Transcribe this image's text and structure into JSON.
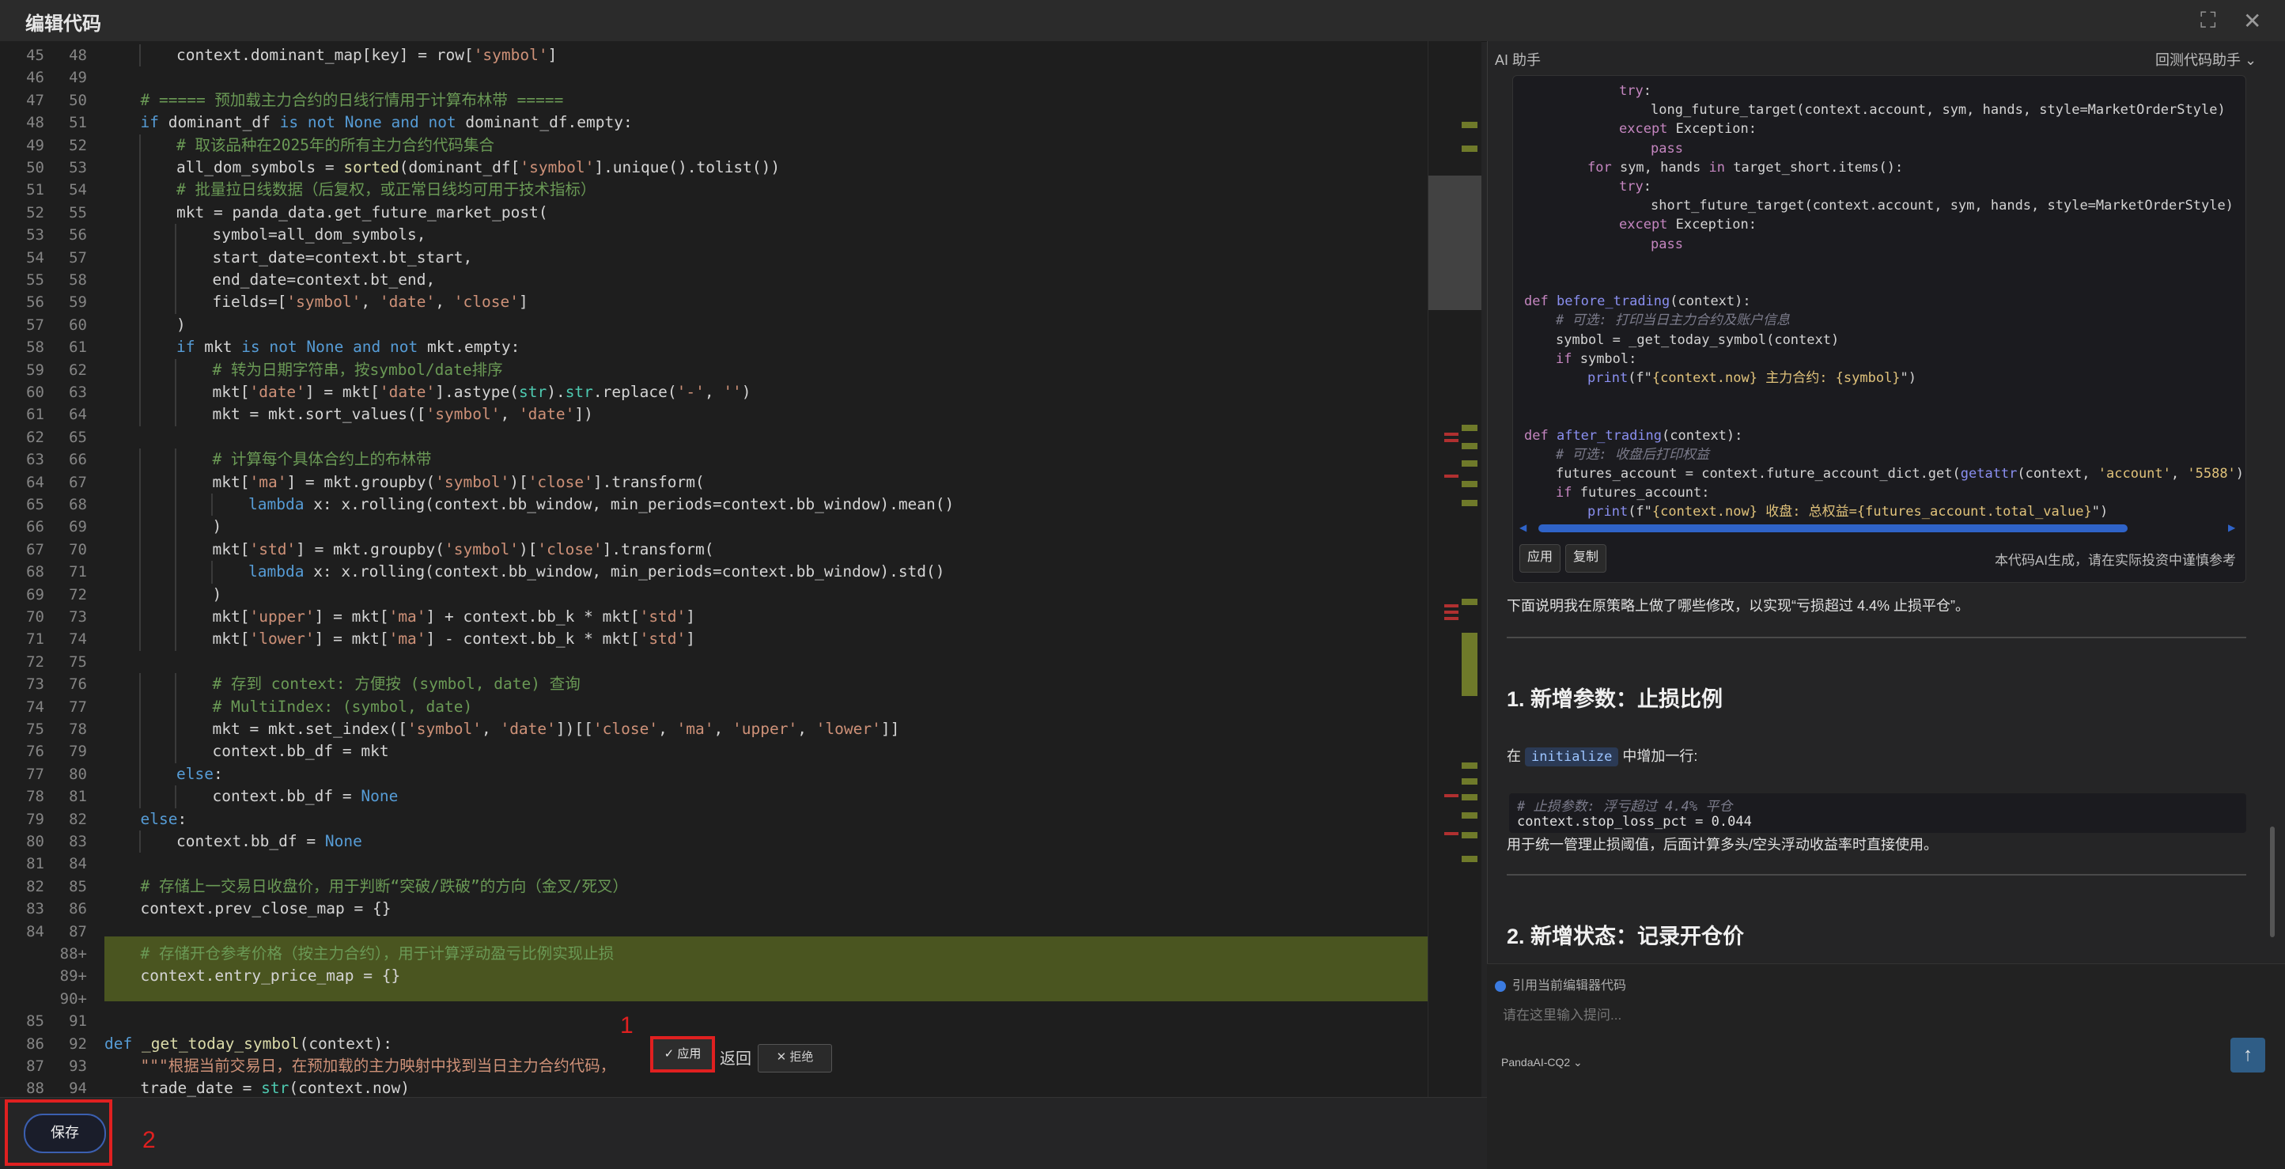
{
  "window": {
    "title": "编辑代码",
    "fullscreen_icon": "fullscreen-icon",
    "close_icon": "close-icon"
  },
  "editor": {
    "lines": [
      {
        "o": "45",
        "n": "48",
        "i": 2,
        "t": [
          [
            "",
            "context.dominant_map[key] = row["
          ],
          [
            "st",
            "'symbol'"
          ],
          [
            "",
            "]"
          ]
        ]
      },
      {
        "o": "46",
        "n": "49",
        "i": 0,
        "t": [
          [
            "",
            ""
          ]
        ]
      },
      {
        "o": "47",
        "n": "50",
        "i": 1,
        "t": [
          [
            "cm",
            "# ===== 预加载主力合约的日线行情用于计算布林带 ====="
          ]
        ]
      },
      {
        "o": "48",
        "n": "51",
        "i": 1,
        "t": [
          [
            "kw",
            "if"
          ],
          [
            "",
            " dominant_df "
          ],
          [
            "kw",
            "is not None and not"
          ],
          [
            "",
            " dominant_df.empty:"
          ]
        ]
      },
      {
        "o": "49",
        "n": "52",
        "i": 2,
        "t": [
          [
            "cm",
            "# 取该品种在2025年的所有主力合约代码集合"
          ]
        ]
      },
      {
        "o": "50",
        "n": "53",
        "i": 2,
        "t": [
          [
            "",
            "all_dom_symbols = "
          ],
          [
            "fn",
            "sorted"
          ],
          [
            "",
            "(dominant_df["
          ],
          [
            "st",
            "'symbol'"
          ],
          [
            "",
            "].unique().tolist())"
          ]
        ]
      },
      {
        "o": "51",
        "n": "54",
        "i": 2,
        "t": [
          [
            "cm",
            "# 批量拉日线数据（后复权，或正常日线均可用于技术指标）"
          ]
        ]
      },
      {
        "o": "52",
        "n": "55",
        "i": 2,
        "t": [
          [
            "",
            "mkt = panda_data.get_future_market_post("
          ]
        ]
      },
      {
        "o": "53",
        "n": "56",
        "i": 3,
        "t": [
          [
            "",
            "symbol=all_dom_symbols,"
          ]
        ]
      },
      {
        "o": "54",
        "n": "57",
        "i": 3,
        "t": [
          [
            "",
            "start_date=context.bt_start,"
          ]
        ]
      },
      {
        "o": "55",
        "n": "58",
        "i": 3,
        "t": [
          [
            "",
            "end_date=context.bt_end,"
          ]
        ]
      },
      {
        "o": "56",
        "n": "59",
        "i": 3,
        "t": [
          [
            "",
            "fields=["
          ],
          [
            "st",
            "'symbol'"
          ],
          [
            "",
            ", "
          ],
          [
            "st",
            "'date'"
          ],
          [
            "",
            ", "
          ],
          [
            "st",
            "'close'"
          ],
          [
            "",
            "]"
          ]
        ]
      },
      {
        "o": "57",
        "n": "60",
        "i": 2,
        "t": [
          [
            "",
            ")"
          ]
        ]
      },
      {
        "o": "58",
        "n": "61",
        "i": 2,
        "t": [
          [
            "kw",
            "if"
          ],
          [
            "",
            " mkt "
          ],
          [
            "kw",
            "is not None and not"
          ],
          [
            "",
            " mkt.empty:"
          ]
        ]
      },
      {
        "o": "59",
        "n": "62",
        "i": 3,
        "t": [
          [
            "cm",
            "# 转为日期字符串，按symbol/date排序"
          ]
        ]
      },
      {
        "o": "60",
        "n": "63",
        "i": 3,
        "t": [
          [
            "",
            "mkt["
          ],
          [
            "st",
            "'date'"
          ],
          [
            "",
            "] = mkt["
          ],
          [
            "st",
            "'date'"
          ],
          [
            "",
            "].astype("
          ],
          [
            "bt",
            "str"
          ],
          [
            "",
            ")."
          ],
          [
            "bt",
            "str"
          ],
          [
            "",
            ".replace("
          ],
          [
            "st",
            "'-'"
          ],
          [
            "",
            ", "
          ],
          [
            "st",
            "''"
          ],
          [
            "",
            ")"
          ]
        ]
      },
      {
        "o": "61",
        "n": "64",
        "i": 3,
        "t": [
          [
            "",
            "mkt = mkt.sort_values(["
          ],
          [
            "st",
            "'symbol'"
          ],
          [
            "",
            ", "
          ],
          [
            "st",
            "'date'"
          ],
          [
            "",
            "])"
          ]
        ]
      },
      {
        "o": "62",
        "n": "65",
        "i": 0,
        "t": [
          [
            "",
            ""
          ]
        ]
      },
      {
        "o": "63",
        "n": "66",
        "i": 3,
        "t": [
          [
            "cm",
            "# 计算每个具体合约上的布林带"
          ]
        ]
      },
      {
        "o": "64",
        "n": "67",
        "i": 3,
        "t": [
          [
            "",
            "mkt["
          ],
          [
            "st",
            "'ma'"
          ],
          [
            "",
            "] = mkt.groupby("
          ],
          [
            "st",
            "'symbol'"
          ],
          [
            "",
            ")["
          ],
          [
            "st",
            "'close'"
          ],
          [
            "",
            "].transform("
          ]
        ]
      },
      {
        "o": "65",
        "n": "68",
        "i": 4,
        "t": [
          [
            "kw",
            "lambda"
          ],
          [
            "",
            " x: x.rolling(context.bb_window, min_periods=context.bb_window).mean()"
          ]
        ]
      },
      {
        "o": "66",
        "n": "69",
        "i": 3,
        "t": [
          [
            "",
            ")"
          ]
        ]
      },
      {
        "o": "67",
        "n": "70",
        "i": 3,
        "t": [
          [
            "",
            "mkt["
          ],
          [
            "st",
            "'std'"
          ],
          [
            "",
            "] = mkt.groupby("
          ],
          [
            "st",
            "'symbol'"
          ],
          [
            "",
            ")["
          ],
          [
            "st",
            "'close'"
          ],
          [
            "",
            "].transform("
          ]
        ]
      },
      {
        "o": "68",
        "n": "71",
        "i": 4,
        "t": [
          [
            "kw",
            "lambda"
          ],
          [
            "",
            " x: x.rolling(context.bb_window, min_periods=context.bb_window).std()"
          ]
        ]
      },
      {
        "o": "69",
        "n": "72",
        "i": 3,
        "t": [
          [
            "",
            ")"
          ]
        ]
      },
      {
        "o": "70",
        "n": "73",
        "i": 3,
        "t": [
          [
            "",
            "mkt["
          ],
          [
            "st",
            "'upper'"
          ],
          [
            "",
            "] = mkt["
          ],
          [
            "st",
            "'ma'"
          ],
          [
            "",
            "] + context.bb_k * mkt["
          ],
          [
            "st",
            "'std'"
          ],
          [
            "",
            "]"
          ]
        ]
      },
      {
        "o": "71",
        "n": "74",
        "i": 3,
        "t": [
          [
            "",
            "mkt["
          ],
          [
            "st",
            "'lower'"
          ],
          [
            "",
            "] = mkt["
          ],
          [
            "st",
            "'ma'"
          ],
          [
            "",
            "] - context.bb_k * mkt["
          ],
          [
            "st",
            "'std'"
          ],
          [
            "",
            "]"
          ]
        ]
      },
      {
        "o": "72",
        "n": "75",
        "i": 0,
        "t": [
          [
            "",
            ""
          ]
        ]
      },
      {
        "o": "73",
        "n": "76",
        "i": 3,
        "t": [
          [
            "cm",
            "# 存到 context: 方便按 (symbol, date) 查询"
          ]
        ]
      },
      {
        "o": "74",
        "n": "77",
        "i": 3,
        "t": [
          [
            "cm",
            "# MultiIndex: (symbol, date)"
          ]
        ]
      },
      {
        "o": "75",
        "n": "78",
        "i": 3,
        "t": [
          [
            "",
            "mkt = mkt.set_index(["
          ],
          [
            "st",
            "'symbol'"
          ],
          [
            "",
            ", "
          ],
          [
            "st",
            "'date'"
          ],
          [
            "",
            "])[["
          ],
          [
            "st",
            "'close'"
          ],
          [
            "",
            ", "
          ],
          [
            "st",
            "'ma'"
          ],
          [
            "",
            ", "
          ],
          [
            "st",
            "'upper'"
          ],
          [
            "",
            ", "
          ],
          [
            "st",
            "'lower'"
          ],
          [
            "",
            "]]"
          ]
        ]
      },
      {
        "o": "76",
        "n": "79",
        "i": 3,
        "t": [
          [
            "",
            "context.bb_df = mkt"
          ]
        ]
      },
      {
        "o": "77",
        "n": "80",
        "i": 2,
        "t": [
          [
            "kw",
            "else"
          ],
          [
            "",
            ":"
          ]
        ]
      },
      {
        "o": "78",
        "n": "81",
        "i": 3,
        "t": [
          [
            "",
            "context.bb_df = "
          ],
          [
            "kw",
            "None"
          ]
        ]
      },
      {
        "o": "79",
        "n": "82",
        "i": 1,
        "t": [
          [
            "kw",
            "else"
          ],
          [
            "",
            ":"
          ]
        ]
      },
      {
        "o": "80",
        "n": "83",
        "i": 2,
        "t": [
          [
            "",
            "context.bb_df = "
          ],
          [
            "kw",
            "None"
          ]
        ]
      },
      {
        "o": "81",
        "n": "84",
        "i": 0,
        "t": [
          [
            "",
            ""
          ]
        ]
      },
      {
        "o": "82",
        "n": "85",
        "i": 1,
        "t": [
          [
            "cm",
            "# 存储上一交易日收盘价，用于判断“突破/跌破”的方向（金叉/死叉）"
          ]
        ]
      },
      {
        "o": "83",
        "n": "86",
        "i": 1,
        "t": [
          [
            "",
            "context.prev_close_map = {}"
          ]
        ]
      },
      {
        "o": "84",
        "n": "87",
        "i": 0,
        "t": [
          [
            "",
            ""
          ]
        ]
      },
      {
        "o": "",
        "n": "88+",
        "i": 1,
        "t": [
          [
            "cm",
            "# 存储开仓参考价格（按主力合约），用于计算浮动盈亏比例实现止损"
          ]
        ]
      },
      {
        "o": "",
        "n": "89+",
        "i": 1,
        "t": [
          [
            "",
            "context.entry_price_map = {}"
          ]
        ]
      },
      {
        "o": "",
        "n": "90+",
        "i": 0,
        "t": [
          [
            "",
            ""
          ]
        ]
      },
      {
        "o": "85",
        "n": "91",
        "i": 0,
        "t": [
          [
            "",
            ""
          ]
        ]
      },
      {
        "o": "86",
        "n": "92",
        "i": 0,
        "t": [
          [
            "kw",
            "def"
          ],
          [
            "",
            " "
          ],
          [
            "fn",
            "_get_today_symbol"
          ],
          [
            "",
            "(context):"
          ]
        ]
      },
      {
        "o": "87",
        "n": "93",
        "i": 1,
        "t": [
          [
            "st",
            "\"\"\"根据当前交易日，在预加载的主力映射中找到当日主力合约代码，"
          ]
        ]
      },
      {
        "o": "88",
        "n": "94",
        "i": 1,
        "t": [
          [
            "",
            "trade_date = "
          ],
          [
            "bt",
            "str"
          ],
          [
            "",
            "(context.now)"
          ]
        ]
      }
    ],
    "diff_apply_label": "✓ 应用",
    "diff_reject_label": "✕ 拒绝",
    "diff_trailing_text": "返回",
    "annotation_1": "1",
    "annotation_2": "2"
  },
  "bottom": {
    "save_label": "保存"
  },
  "ai": {
    "header": "AI 助手",
    "assistant_select": "回测代码助手 ⌄",
    "code_lines": [
      {
        "i": 3,
        "t": [
          [
            "pk",
            "try"
          ],
          [
            "",
            ":"
          ]
        ]
      },
      {
        "i": 4,
        "t": [
          [
            "",
            "long_future_target(context.account, sym, hands, style=MarketOrderStyle)"
          ]
        ]
      },
      {
        "i": 3,
        "t": [
          [
            "pk",
            "except"
          ],
          [
            "",
            " Exception:"
          ]
        ]
      },
      {
        "i": 4,
        "t": [
          [
            "pk",
            "pass"
          ]
        ]
      },
      {
        "i": 2,
        "t": [
          [
            "pk",
            "for"
          ],
          [
            "",
            " sym, hands "
          ],
          [
            "pk",
            "in"
          ],
          [
            "",
            " target_short.items():"
          ]
        ]
      },
      {
        "i": 3,
        "t": [
          [
            "pk",
            "try"
          ],
          [
            "",
            ":"
          ]
        ]
      },
      {
        "i": 4,
        "t": [
          [
            "",
            "short_future_target(context.account, sym, hands, style=MarketOrderStyle)"
          ]
        ]
      },
      {
        "i": 3,
        "t": [
          [
            "pk",
            "except"
          ],
          [
            "",
            " Exception:"
          ]
        ]
      },
      {
        "i": 4,
        "t": [
          [
            "pk",
            "pass"
          ]
        ]
      },
      {
        "i": 0,
        "t": [
          [
            "",
            ""
          ]
        ]
      },
      {
        "i": 0,
        "t": [
          [
            "",
            ""
          ]
        ]
      },
      {
        "i": 0,
        "t": [
          [
            "pk",
            "def"
          ],
          [
            "",
            " "
          ],
          [
            "pf",
            "before_trading"
          ],
          [
            "",
            "(context):"
          ]
        ]
      },
      {
        "i": 1,
        "t": [
          [
            "pc",
            "# 可选: 打印当日主力合约及账户信息"
          ]
        ]
      },
      {
        "i": 1,
        "t": [
          [
            "",
            "symbol = _get_today_symbol(context)"
          ]
        ]
      },
      {
        "i": 1,
        "t": [
          [
            "pk",
            "if"
          ],
          [
            "",
            " symbol:"
          ]
        ]
      },
      {
        "i": 2,
        "t": [
          [
            "pf",
            "print"
          ],
          [
            "",
            "(f\""
          ],
          [
            "ps",
            "{context.now} 主力合约: {symbol}"
          ],
          [
            "",
            "\")"
          ]
        ]
      },
      {
        "i": 0,
        "t": [
          [
            "",
            ""
          ]
        ]
      },
      {
        "i": 0,
        "t": [
          [
            "",
            ""
          ]
        ]
      },
      {
        "i": 0,
        "t": [
          [
            "pk",
            "def"
          ],
          [
            "",
            " "
          ],
          [
            "pf",
            "after_trading"
          ],
          [
            "",
            "(context):"
          ]
        ]
      },
      {
        "i": 1,
        "t": [
          [
            "pc",
            "# 可选: 收盘后打印权益"
          ]
        ]
      },
      {
        "i": 1,
        "t": [
          [
            "",
            "futures_account = context.future_account_dict.get("
          ],
          [
            "pf",
            "getattr"
          ],
          [
            "",
            "(context, "
          ],
          [
            "ps",
            "'account'"
          ],
          [
            "",
            ", "
          ],
          [
            "ps",
            "'5588'"
          ],
          [
            "",
            "))"
          ]
        ]
      },
      {
        "i": 1,
        "t": [
          [
            "pk",
            "if"
          ],
          [
            "",
            " futures_account:"
          ]
        ]
      },
      {
        "i": 2,
        "t": [
          [
            "pf",
            "print"
          ],
          [
            "",
            "(f\""
          ],
          [
            "ps",
            "{context.now} 收盘: 总权益={futures_account.total_value}"
          ],
          [
            "",
            "\")"
          ]
        ]
      }
    ],
    "card_apply": "应用",
    "card_copy": "复制",
    "card_note": "本代码AI生成，请在实际投资中谨慎参考",
    "intro": "下面说明我在原策略上做了哪些修改，以实现“亏损超过 4.4% 止损平仓”。",
    "section1_title": "1. 新增参数：止损比例",
    "section1_pre": "在",
    "section1_code": "initialize",
    "section1_post": "中增加一行:",
    "snippet_comment": "# 止损参数: 浮亏超过 4.4% 平仓",
    "snippet_code": "context.stop_loss_pct = 0.044",
    "section1_desc": "用于统一管理止损阈值，后面计算多头/空头浮动收益率时直接使用。",
    "section2_title": "2. 新增状态：记录开仓价",
    "ref_text": "引用当前编辑器代码",
    "input_placeholder": "请在这里输入提问...",
    "model": "PandaAI-CQ2 ⌄",
    "send_icon": "send-icon"
  }
}
